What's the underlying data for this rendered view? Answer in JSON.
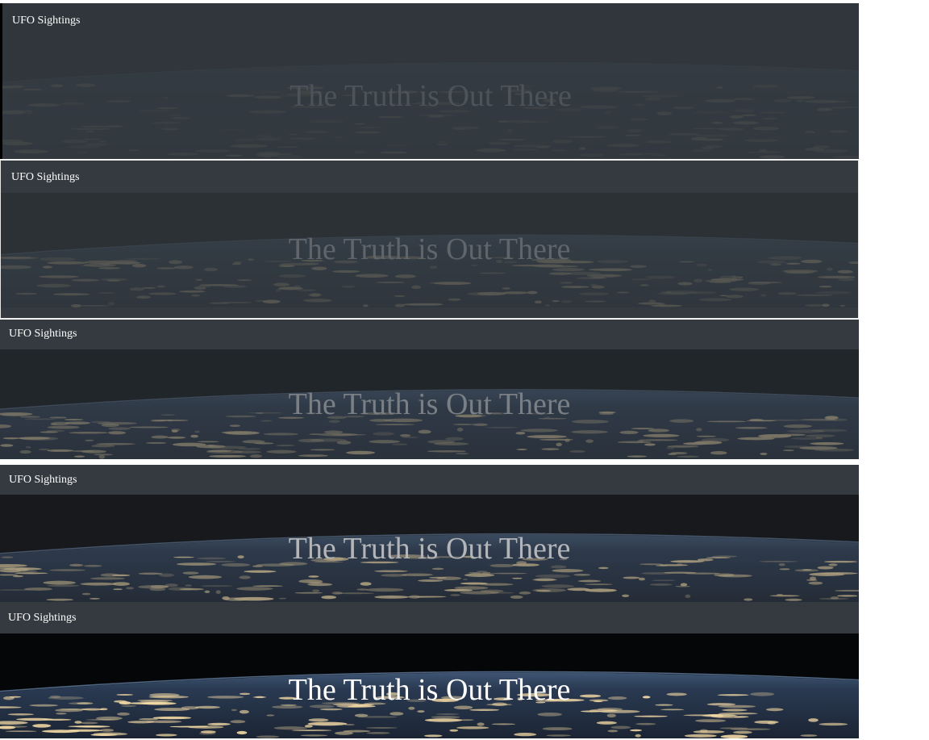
{
  "frames": [
    {
      "brand": "UFO Sightings",
      "hero_text": "The Truth is Out There",
      "overlay_opacity": 0.93
    },
    {
      "brand": "UFO Sightings",
      "hero_text": "The Truth is Out There",
      "overlay_opacity": 0.82
    },
    {
      "brand": "UFO Sightings",
      "hero_text": "The Truth is Out There",
      "overlay_opacity": 0.62
    },
    {
      "brand": "UFO Sightings",
      "hero_text": "The Truth is Out There",
      "overlay_opacity": 0.38
    },
    {
      "brand": "UFO Sightings",
      "hero_text": "The Truth is Out There",
      "overlay_opacity": 0.0
    }
  ],
  "colors": {
    "navbar": "#343a40",
    "space": "#050608",
    "earth_dark": "#1b2433",
    "earth_mid": "#2a3a52",
    "city_lights": "#f3d9a4",
    "atmosphere": "#3e5573"
  },
  "background_image": "earth-at-night-from-space"
}
